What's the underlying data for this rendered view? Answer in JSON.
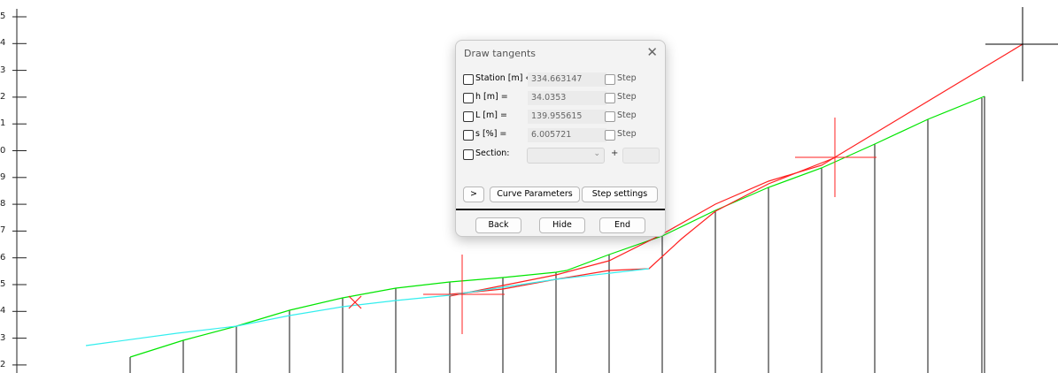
{
  "axis": {
    "tick_labels": [
      "5",
      "4",
      "3",
      "2",
      "1",
      "0",
      "9",
      "8",
      "7",
      "6",
      "5",
      "4",
      "3",
      "2"
    ]
  },
  "chart_data": {
    "type": "line",
    "title": "",
    "xlabel": "",
    "ylabel": "",
    "series": [
      {
        "color": "#00e600",
        "points": [
          [
            147,
            404
          ],
          [
            207,
            385
          ],
          [
            267,
            369
          ],
          [
            327,
            351
          ],
          [
            387,
            337
          ],
          [
            447,
            326
          ],
          [
            508,
            319
          ],
          [
            568,
            314
          ],
          [
            628,
            308
          ],
          [
            640,
            306
          ],
          [
            688,
            288
          ],
          [
            748,
            267
          ],
          [
            808,
            238
          ],
          [
            868,
            212
          ],
          [
            928,
            190
          ],
          [
            988,
            163
          ],
          [
            1048,
            135
          ],
          [
            1112,
            109
          ]
        ]
      },
      {
        "color": "#ff2020",
        "points": [
          [
            508,
            335
          ],
          [
            568,
            323
          ],
          [
            628,
            311
          ],
          [
            688,
            295
          ],
          [
            748,
            265
          ],
          [
            808,
            231
          ],
          [
            868,
            205
          ],
          [
            928,
            187
          ],
          [
            1155,
            50
          ]
        ]
      },
      {
        "color": "#ff2020",
        "points": [
          [
            508,
            333
          ],
          [
            568,
            327
          ],
          [
            628,
            316
          ],
          [
            688,
            306
          ],
          [
            733,
            304
          ],
          [
            770,
            270
          ],
          [
            808,
            239
          ],
          [
            868,
            208
          ],
          [
            944,
            178
          ]
        ]
      },
      {
        "color": "#33eeee",
        "points": [
          [
            97,
            391
          ],
          [
            200,
            377
          ],
          [
            267,
            369
          ],
          [
            327,
            357
          ],
          [
            387,
            347
          ],
          [
            447,
            340
          ],
          [
            508,
            334
          ],
          [
            628,
            316
          ],
          [
            733,
            304
          ]
        ]
      }
    ]
  },
  "dialog": {
    "title": "Draw tangents",
    "close_icon": "✕",
    "rows": [
      {
        "label": "Station [m] ‹",
        "value": "334.663147",
        "step": "Step"
      },
      {
        "label": "h [m] =",
        "value": "34.0353",
        "step": "Step"
      },
      {
        "label": "L [m] =",
        "value": "139.955615",
        "step": "Step"
      },
      {
        "label": "s [%] =",
        "value": "6.005721",
        "step": "Step"
      }
    ],
    "section_label": "Section:",
    "section_value": "",
    "plus": "+",
    "expand_label": ">",
    "curve_params_label": "Curve Parameters",
    "step_settings_label": "Step settings",
    "back_label": "Back",
    "hide_label": "Hide",
    "end_label": "End"
  }
}
